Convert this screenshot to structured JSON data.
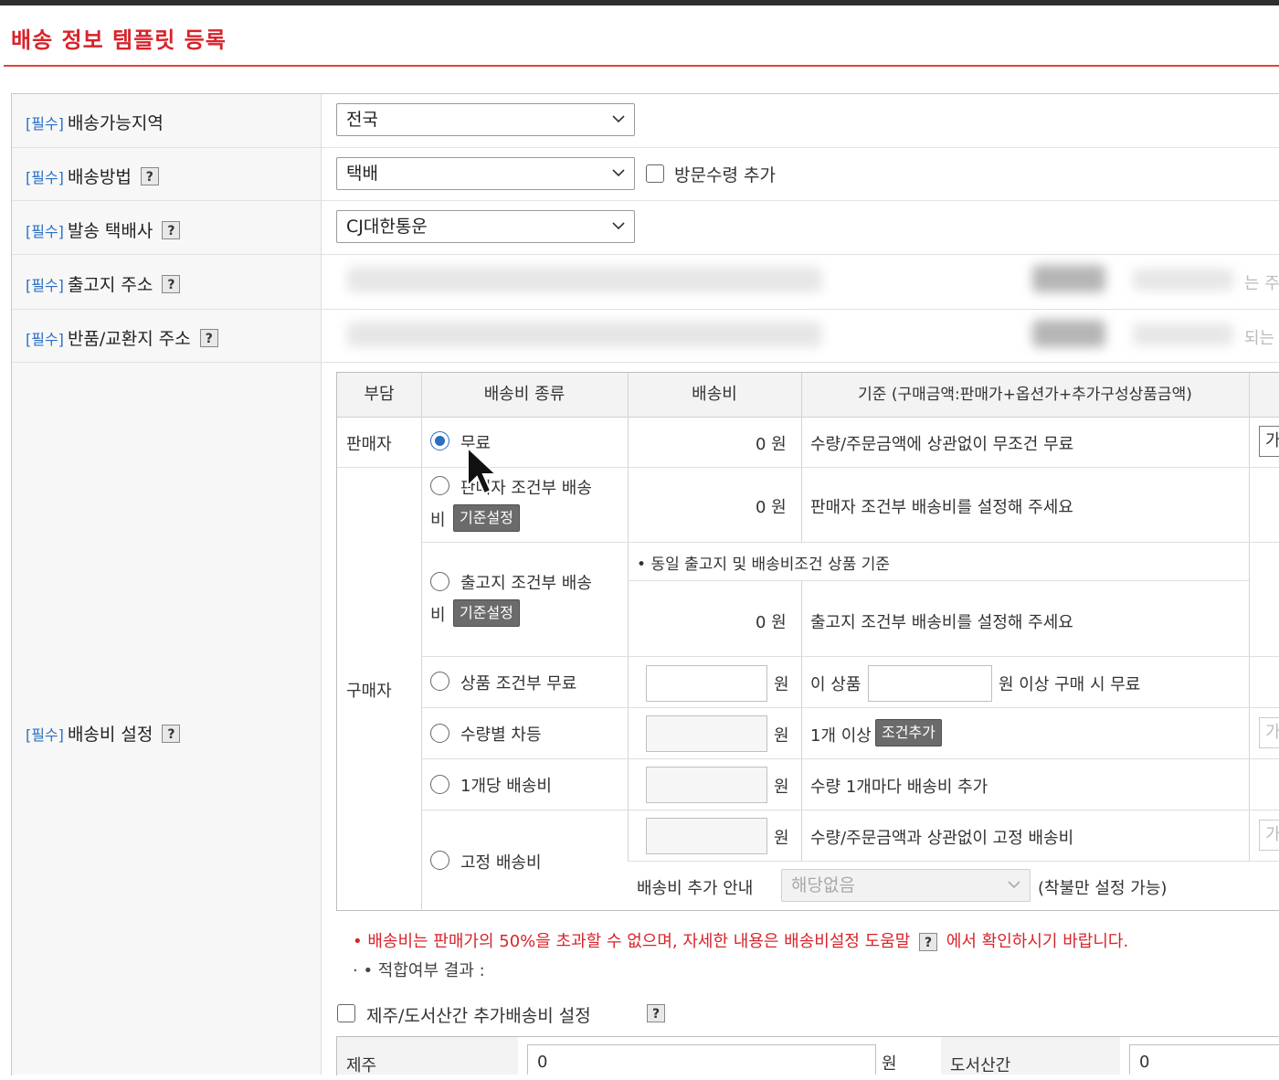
{
  "page": {
    "title": "배송 정보 템플릿 등록"
  },
  "required_tag": "[필수]",
  "fields": {
    "region": {
      "label": "배송가능지역",
      "value": "전국"
    },
    "method": {
      "label": "배송방법",
      "value": "택배",
      "visit_pickup_label": "방문수령 추가"
    },
    "courier": {
      "label": "발송 택배사",
      "value": "CJ대한통운"
    },
    "origin": {
      "label": "출고지 주소",
      "edge_text": "는 주"
    },
    "return": {
      "label": "반품/교환지 주소",
      "edge_text": "되는"
    },
    "fee": {
      "label": "배송비 설정"
    }
  },
  "fee_table": {
    "headers": [
      "부담",
      "배송비 종류",
      "배송비",
      "기준 (구매금액:판매가+옵션가+추가구성상품금액)"
    ],
    "payer_seller": "판매자",
    "payer_buyer": "구매자",
    "won": "원",
    "rows": {
      "free": {
        "label": "무료",
        "fee": "0 원",
        "criteria": "수량/주문금액에 상관없이 무조건 무료",
        "edge_box": "가"
      },
      "seller_cond": {
        "label_line1": "판매자 조건부 배송",
        "label_line2": "비",
        "btn": "기준설정",
        "fee": "0 원",
        "criteria": "판매자 조건부 배송비를 설정해 주세요"
      },
      "origin_cond": {
        "label_line1": "출고지 조건부 배송",
        "label_line2": "비",
        "btn": "기준설정",
        "note": "동일 출고지 및 배송비조건 상품 기준",
        "fee": "0 원",
        "criteria": "출고지 조건부 배송비를 설정해 주세요"
      },
      "product_cond": {
        "label": "상품 조건부 무료",
        "criteria_prefix": "이 상품",
        "criteria_suffix": "원 이상 구매 시 무료"
      },
      "qty_tier": {
        "label": "수량별 차등",
        "criteria": "1개 이상",
        "btn": "조건추가",
        "edge_box": "가"
      },
      "per_item": {
        "label": "1개당 배송비",
        "criteria": "수량 1개마다 배송비 추가"
      },
      "fixed": {
        "label": "고정 배송비",
        "criteria": "수량/주문금액과 상관없이 고정 배송비",
        "edge_box": "가",
        "extra_label": "배송비 추가 안내",
        "extra_select": "해당없음",
        "extra_note": "(착불만 설정 가능)"
      }
    }
  },
  "notes": {
    "warning_pre": "배송비는 판매가의 50%을 초과할 수 없으며, 자세한 내용은 배송비설정 도움말",
    "warning_post": "에서 확인하시기 바랍니다.",
    "result": "적합여부 결과 :"
  },
  "island": {
    "checkbox_label": "제주/도서산간 추가배송비 설정",
    "jeju_label": "제주",
    "jeju_value": "0",
    "won": "원",
    "island_label": "도서산간",
    "island_value": "0"
  },
  "colors": {
    "accent": "#d8232a",
    "link": "#2a6fc4"
  }
}
